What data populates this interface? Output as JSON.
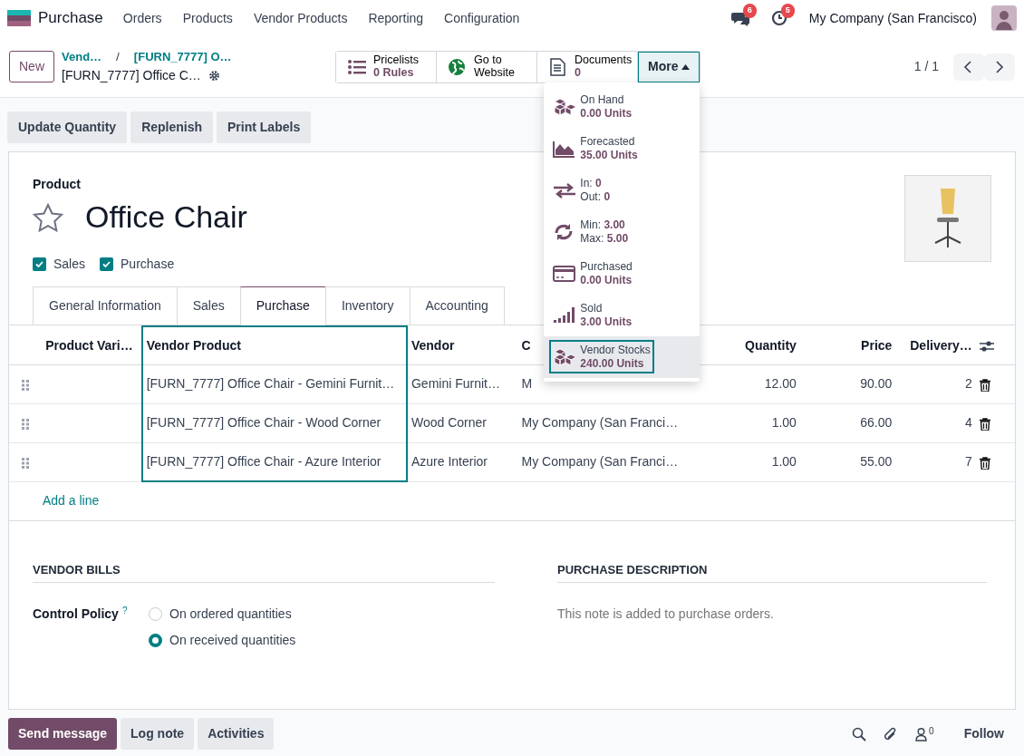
{
  "app": {
    "name": "Purchase",
    "menu": [
      "Orders",
      "Products",
      "Vendor Products",
      "Reporting",
      "Configuration"
    ],
    "messages_badge": "6",
    "activities_badge": "5",
    "company": "My Company (San Francisco)"
  },
  "control_panel": {
    "new_button": "New",
    "breadcrumbs": [
      "Vend…",
      "[FURN_7777] O…"
    ],
    "breadcrumb_separator": "/",
    "record": "[FURN_7777] Office C…",
    "smart_buttons": [
      {
        "label": "Pricelists",
        "value": "0 Rules"
      },
      {
        "label": "Go to",
        "value": "Website"
      },
      {
        "label": "Documents",
        "value": "0"
      }
    ],
    "more": {
      "label": "More",
      "expanded": true
    },
    "pager": "1 / 1"
  },
  "more_menu": [
    {
      "kind": "stacked",
      "label": "On Hand",
      "value": "0.00 Units",
      "highlighted": false
    },
    {
      "kind": "stacked",
      "label": "Forecasted",
      "value": "35.00 Units",
      "highlighted": false
    },
    {
      "kind": "pairs",
      "pairs": [
        {
          "label": "In:",
          "value": "0"
        },
        {
          "label": "Out:",
          "value": "0"
        }
      ],
      "highlighted": false
    },
    {
      "kind": "pairs",
      "pairs": [
        {
          "label": "Min:",
          "value": "3.00"
        },
        {
          "label": "Max:",
          "value": "5.00"
        }
      ],
      "highlighted": false
    },
    {
      "kind": "stacked",
      "label": "Purchased",
      "value": "0.00 Units",
      "highlighted": false
    },
    {
      "kind": "stacked",
      "label": "Sold",
      "value": "3.00 Units",
      "highlighted": false
    },
    {
      "kind": "stacked",
      "label": "Vendor Stocks",
      "value": "240.00 Units",
      "highlighted": true
    }
  ],
  "actions": [
    "Update Quantity",
    "Replenish",
    "Print Labels"
  ],
  "product": {
    "label": "Product",
    "name": "Office Chair",
    "favorite": false,
    "checkboxes": [
      {
        "label": "Sales",
        "checked": true
      },
      {
        "label": "Purchase",
        "checked": true
      }
    ]
  },
  "tabs": [
    {
      "label": "General Information",
      "selected": false
    },
    {
      "label": "Sales",
      "selected": false
    },
    {
      "label": "Purchase",
      "selected": true
    },
    {
      "label": "Inventory",
      "selected": false
    },
    {
      "label": "Accounting",
      "selected": false
    }
  ],
  "table": {
    "columns": [
      {
        "label": "Product Vari…",
        "highlighted": false
      },
      {
        "label": "Vendor Product",
        "highlighted": true
      },
      {
        "label": "Vendor",
        "highlighted": false
      },
      {
        "label": "C",
        "highlighted": false
      },
      {
        "label": "Quantity",
        "highlighted": false
      },
      {
        "label": "Price",
        "highlighted": false
      },
      {
        "label": "Delivery…",
        "highlighted": false
      }
    ],
    "rows": [
      {
        "vendor_product": "[FURN_7777] Office Chair - Gemini Furnit…",
        "vendor": "Gemini Furnit…",
        "company": "M",
        "quantity": "12.00",
        "price": "90.00",
        "delivery": "2"
      },
      {
        "vendor_product": "[FURN_7777] Office Chair - Wood Corner",
        "vendor": "Wood Corner",
        "company": "My Company (San Franci…",
        "quantity": "1.00",
        "price": "66.00",
        "delivery": "4"
      },
      {
        "vendor_product": "[FURN_7777] Office Chair - Azure Interior",
        "vendor": "Azure Interior",
        "company": "My Company (San Franci…",
        "quantity": "1.00",
        "price": "55.00",
        "delivery": "7"
      }
    ],
    "add_line": "Add a line"
  },
  "vendor_bills": {
    "title": "VENDOR BILLS",
    "field": "Control Policy",
    "help": "?",
    "options": [
      {
        "label": "On ordered quantities",
        "selected": false
      },
      {
        "label": "On received quantities",
        "selected": true
      }
    ]
  },
  "purchase_description": {
    "title": "PURCHASE DESCRIPTION",
    "placeholder": "This note is added to purchase orders."
  },
  "chatter": {
    "buttons": [
      "Send message",
      "Log note",
      "Activities"
    ],
    "followers": "0",
    "follow": "Follow"
  }
}
